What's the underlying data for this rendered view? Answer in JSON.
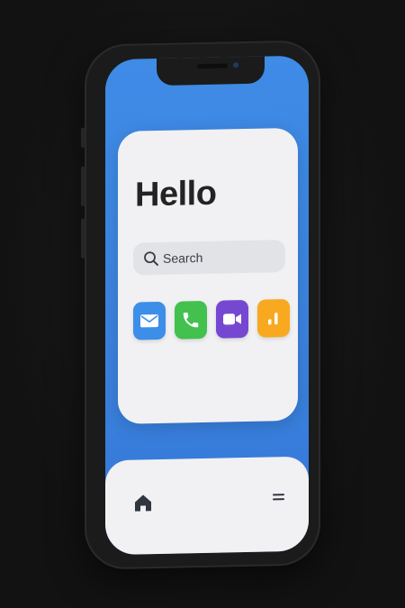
{
  "greeting": "Hello",
  "search": {
    "placeholder": "Search",
    "icon": "search-icon"
  },
  "apps": [
    {
      "name": "mail",
      "icon": "mail-icon",
      "color": "#3d8ee8"
    },
    {
      "name": "phone",
      "icon": "phone-icon",
      "color": "#42c14f"
    },
    {
      "name": "video",
      "icon": "video-icon",
      "color": "#7648d2"
    },
    {
      "name": "analytics",
      "icon": "bar-chart-icon",
      "color": "#f8a91f"
    }
  ],
  "dock": {
    "left_icon": "home-icon",
    "right_icon": "menu-icon"
  },
  "colors": {
    "wallpaper": "#3f8be6",
    "card": "#f1f1f3",
    "phone_frame": "#1b1b1b"
  }
}
